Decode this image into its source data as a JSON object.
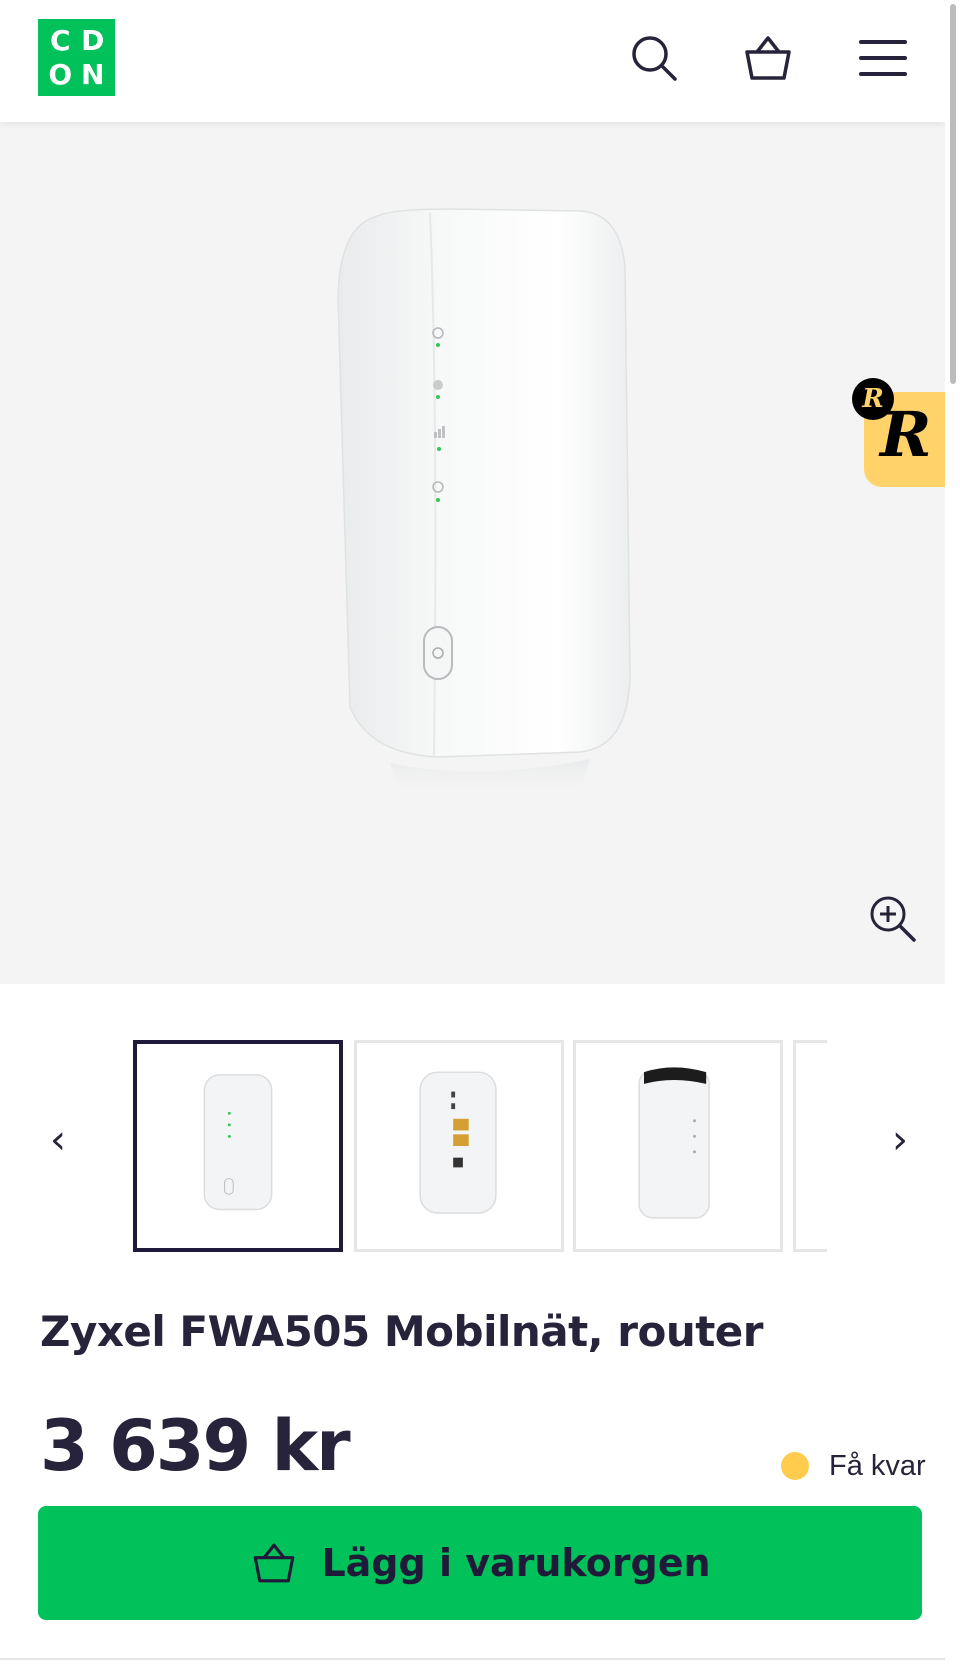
{
  "header": {
    "logo_letters": [
      "C",
      "D",
      "O",
      "N"
    ],
    "icons": [
      "search-icon",
      "basket-icon",
      "menu-icon"
    ]
  },
  "product": {
    "title": "Zyxel FWA505 Mobilnät, router",
    "price": "3 639 kr",
    "stock_label": "Få kvar",
    "stock_color": "#ffcc4d"
  },
  "gallery": {
    "prev_label": "‹",
    "next_label": "›",
    "thumbnails": [
      "router-front",
      "router-back",
      "router-angle",
      "router-partial"
    ],
    "active_index": 0
  },
  "cta": {
    "label": "Lägg i varukorgen",
    "color": "#00c15a"
  },
  "badge": {
    "small_letter": "R",
    "big_letter": "R",
    "color": "#ffd36a"
  },
  "colors": {
    "brand_green": "#00c15a",
    "text_dark": "#26233a"
  }
}
